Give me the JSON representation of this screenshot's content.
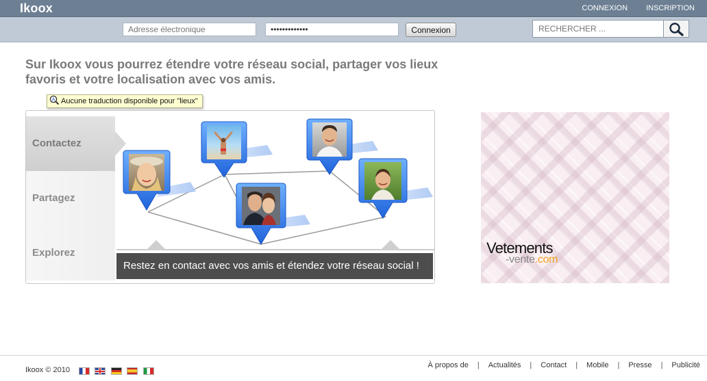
{
  "header": {
    "logo": "Ikoox",
    "links": {
      "login": "CONNEXION",
      "signup": "INSCRIPTION"
    }
  },
  "login": {
    "email_placeholder": "Adresse électronique",
    "password_value": "•••••••••••••",
    "button_label": "Connexion"
  },
  "search": {
    "placeholder": "RECHERCHER ..."
  },
  "main": {
    "headline": "Sur Ikoox vous pourrez étendre votre réseau social, partager vos lieux favoris et votre localisation avec vos amis.",
    "tooltip": "Aucune traduction disponible pour \"lieux\"",
    "tabs": [
      {
        "label": "Contactez",
        "active": true
      },
      {
        "label": "Partagez",
        "active": false
      },
      {
        "label": "Explorez",
        "active": false
      }
    ],
    "caption": "Restez en contact avec vos amis et étendez votre réseau social !"
  },
  "ad": {
    "brand": "Vetements",
    "sub_1": "-vente",
    "sub_2": ".com"
  },
  "footer": {
    "copyright": "Ikoox © 2010",
    "flags": [
      "fr",
      "en",
      "de",
      "es",
      "it"
    ],
    "links": [
      "À propos de",
      "Actualités",
      "Contact",
      "Mobile",
      "Presse",
      "Publicité"
    ]
  },
  "colors": {
    "topbar": "#6d7f93",
    "loginbar": "#bfcad6",
    "pin_blue": "#2f7ff0",
    "caption_bg": "#4d4d4d",
    "ad_orange": "#f0a01e"
  }
}
